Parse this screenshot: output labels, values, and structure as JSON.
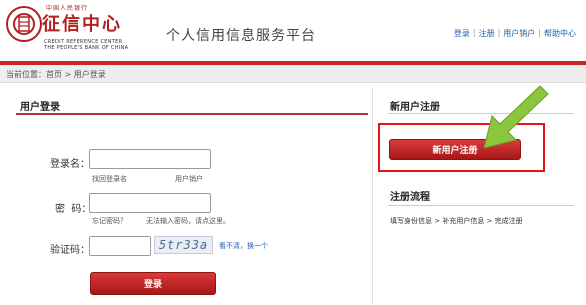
{
  "header": {
    "logo_small": "中国人民银行",
    "logo_big": "征信中心",
    "logo_en_line1": "CREDIT REFERENCE CENTER",
    "logo_en_line2": "THE PEOPLE'S BANK OF CHINA",
    "platform_title": "个人信用信息服务平台",
    "links": [
      "登录",
      "注册",
      "用户销户",
      "帮助中心"
    ]
  },
  "breadcrumb": "当前位置：首页 > 用户登录",
  "login": {
    "title": "用户登录",
    "username_label": "登录名：",
    "username_value": "",
    "find_username": "找回登录名",
    "cancel_account": "用户销户",
    "password_label": "密  码：",
    "password_value": "",
    "forgot_password": "忘记密码？",
    "cannot_input": "无法输入密码，请点这里。",
    "captcha_label": "验证码：",
    "captcha_value": "",
    "captcha_text": "5tr33a",
    "captcha_refresh": "看不清，换一个",
    "submit": "登录"
  },
  "register": {
    "title": "新用户注册",
    "button": "新用户注册",
    "flow_title": "注册流程",
    "flow_text": "填写身份信息 > 补充用户信息 > 完成注册"
  },
  "colors": {
    "brand_red": "#c9262a",
    "highlight": "#e4151a",
    "arrow_green": "#8cc63f",
    "link_blue": "#1f5fa8"
  }
}
